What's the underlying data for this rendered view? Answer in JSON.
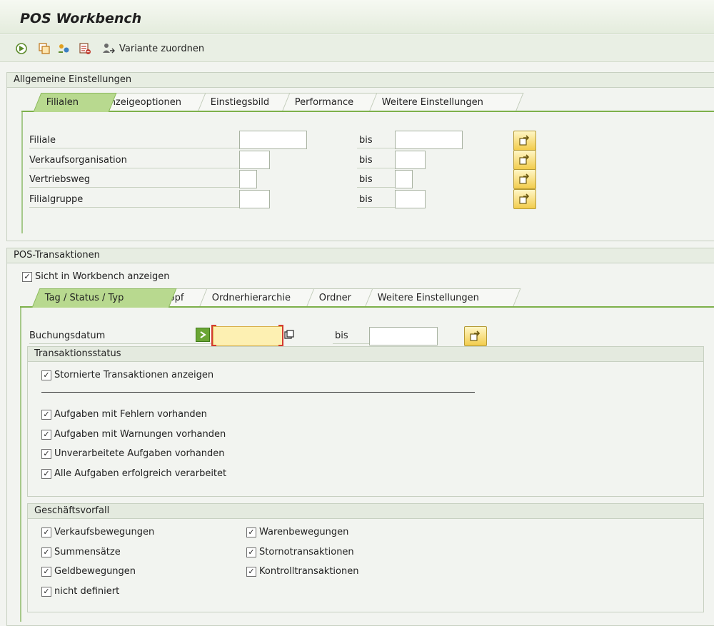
{
  "window": {
    "title": "POS Workbench"
  },
  "toolbar": {
    "variant_label": "Variante zuordnen",
    "icons": [
      "execute-icon",
      "copy-icon",
      "settings-icon",
      "list-delete-icon",
      "user-variant-icon"
    ]
  },
  "general": {
    "title": "Allgemeine Einstellungen",
    "tabs": [
      "Filialen",
      "Anzeigeoptionen",
      "Einstiegsbild",
      "Performance",
      "Weitere Einstellungen"
    ],
    "active_tab": "Filialen",
    "rows": [
      {
        "label": "Filiale",
        "from": "",
        "bis": "bis",
        "to": ""
      },
      {
        "label": "Verkaufsorganisation",
        "from": "",
        "bis": "bis",
        "to": ""
      },
      {
        "label": "Vertriebsweg",
        "from": "",
        "bis": "bis",
        "to": ""
      },
      {
        "label": "Filialgruppe",
        "from": "",
        "bis": "bis",
        "to": ""
      }
    ]
  },
  "pos": {
    "title": "POS-Transaktionen",
    "show_in_workbench": {
      "label": "Sicht in Workbench anzeigen",
      "checked": true
    },
    "tabs": [
      "Tag / Status / Typ",
      "Kopf",
      "Ordnerhierarchie",
      "Ordner",
      "Weitere Einstellungen"
    ],
    "active_tab": "Tag / Status / Typ",
    "booking_date": {
      "label": "Buchungsdatum",
      "from": "",
      "bis": "bis",
      "to": ""
    },
    "status": {
      "title": "Transaktionsstatus",
      "cancelled": {
        "label": "Stornierte Transaktionen anzeigen",
        "checked": true
      },
      "items": [
        {
          "label": "Aufgaben mit Fehlern vorhanden",
          "checked": true
        },
        {
          "label": "Aufgaben mit Warnungen vorhanden",
          "checked": true
        },
        {
          "label": "Unverarbeitete Aufgaben vorhanden",
          "checked": true
        },
        {
          "label": "Alle Aufgaben erfolgreich verarbeitet",
          "checked": true
        }
      ]
    },
    "business": {
      "title": "Geschäftsvorfall",
      "left": [
        {
          "label": "Verkaufsbewegungen",
          "checked": true
        },
        {
          "label": "Summensätze",
          "checked": true
        },
        {
          "label": "Geldbewegungen",
          "checked": true
        },
        {
          "label": "nicht definiert",
          "checked": true
        }
      ],
      "right": [
        {
          "label": "Warenbewegungen",
          "checked": true
        },
        {
          "label": "Stornotransaktionen",
          "checked": true
        },
        {
          "label": "Kontrolltransaktionen",
          "checked": true
        }
      ]
    }
  }
}
